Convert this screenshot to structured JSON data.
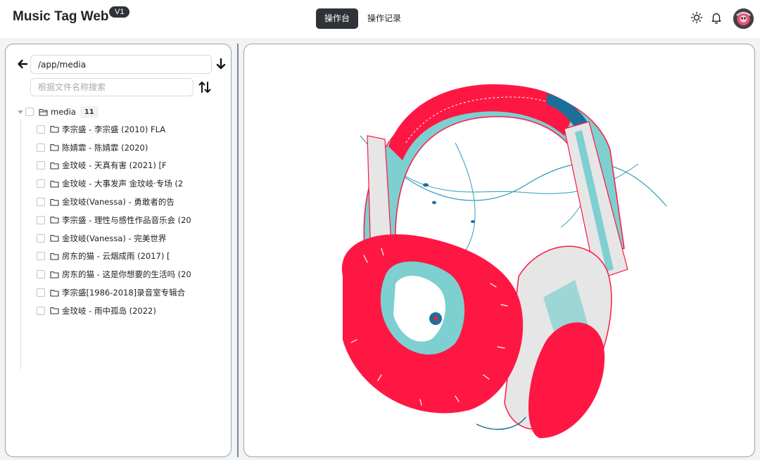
{
  "header": {
    "brand": "Music Tag Web",
    "version": "V1",
    "tabs": [
      {
        "label": "操作台",
        "active": true
      },
      {
        "label": "操作记录",
        "active": false
      }
    ]
  },
  "explorer": {
    "path_value": "/app/media",
    "search_placeholder": "根据文件名称搜索",
    "root": {
      "label": "media",
      "count": "11"
    },
    "items": [
      {
        "label": "李宗盛 - 李宗盛 (2010) FLA"
      },
      {
        "label": "陈婧霏 - 陈婧霏 (2020)"
      },
      {
        "label": "金玟岐 - 天真有害 (2021) [F"
      },
      {
        "label": "金玟岐 - 大事发声 金玟岐·专场 (2"
      },
      {
        "label": "金玟岐(Vanessa) - 勇敢者的告"
      },
      {
        "label": "李宗盛 - 理性与感性作品音乐会 (20"
      },
      {
        "label": "金玟岐(Vanessa) - 完美世界"
      },
      {
        "label": "房东的猫 - 云烟成雨 (2017) ["
      },
      {
        "label": "房东的猫 - 这是你想要的生活吗 (20"
      },
      {
        "label": "李宗盛[1986-2018]录音室专辑合"
      },
      {
        "label": "金玟岐 - 雨中孤岛 (2022)"
      }
    ]
  },
  "icons": {
    "theme": "sun-icon",
    "notifications": "bell-icon",
    "back": "arrow-left-icon",
    "load": "arrow-down-icon",
    "sort": "sort-arrows-icon",
    "folder": "folder-icon"
  },
  "colors": {
    "accent_dark": "#2f3338",
    "headphone_red": "#ff1744",
    "headphone_teal": "#7ecfd0",
    "headphone_blue": "#1d6f9a"
  }
}
